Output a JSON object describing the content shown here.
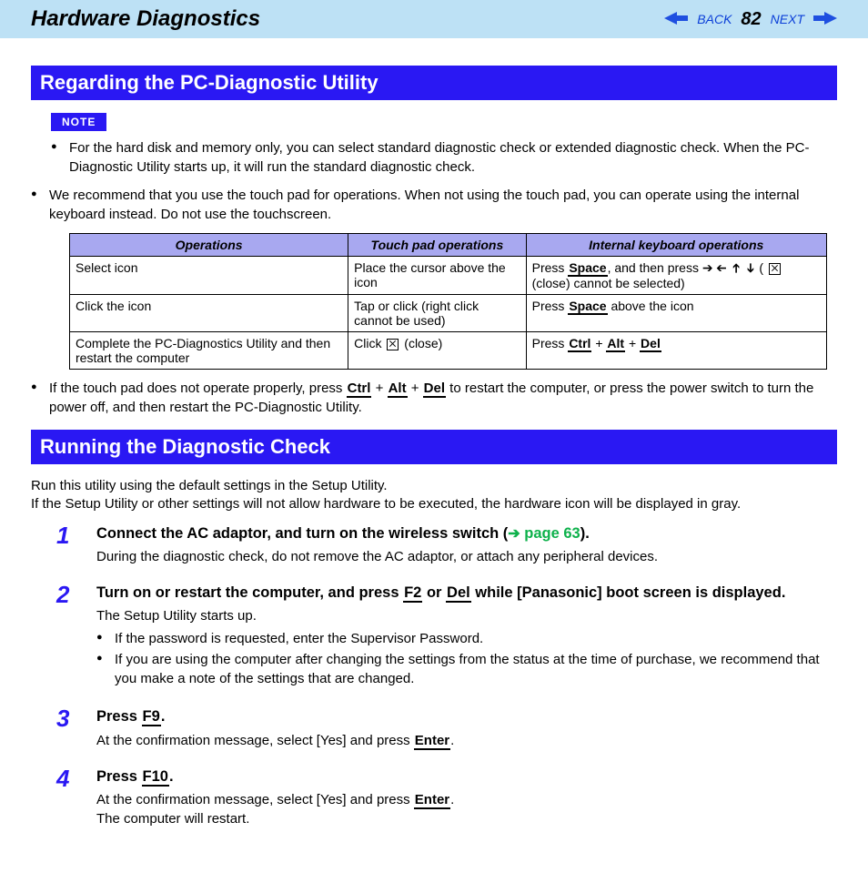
{
  "header": {
    "title": "Hardware Diagnostics",
    "back": "BACK",
    "next": "NEXT",
    "page": "82"
  },
  "section1": {
    "title": "Regarding the PC-Diagnostic Utility",
    "note_label": "NOTE",
    "note_bullet": "For the hard disk and memory only, you can select standard diagnostic check or extended diagnostic check. When the PC-Diagnostic Utility starts up, it will run the standard diagnostic check.",
    "bullet_touch": "We recommend that you use the touch pad for operations. When not using the touch pad, you can operate using the internal keyboard instead. Do not use the touchscreen.",
    "table": {
      "h1": "Operations",
      "h2": "Touch pad operations",
      "h3": "Internal keyboard operations",
      "r1c1": "Select icon",
      "r1c2": "Place the cursor above the icon",
      "r1c3a": "Press ",
      "r1c3b": ", and then press ",
      "r1c3c": " (close) cannot be selected)",
      "r2c1": "Click the icon",
      "r2c2": "Tap or click (right click cannot be used)",
      "r2c3a": "Press ",
      "r2c3b": " above the icon",
      "r3c1": "Complete the PC-Diagnostics Utility and then restart the computer",
      "r3c2a": "Click ",
      "r3c2b": " (close)",
      "r3c3a": "Press "
    },
    "bullet_after_a": "If the touch pad does not operate properly, press ",
    "bullet_after_b": " to restart the computer, or press the power switch to turn the power off, and then restart the PC-Diagnostic Utility."
  },
  "keys": {
    "space": "Space",
    "ctrl": "Ctrl",
    "alt": "Alt",
    "del": "Del",
    "f2": "F2",
    "f9": "F9",
    "f10": "F10",
    "enter": "Enter"
  },
  "section2": {
    "title": "Running the Diagnostic Check",
    "intro1": "Run this utility using the default settings in the Setup Utility.",
    "intro2": "If the Setup Utility or other settings will not allow hardware to be executed, the hardware icon will be displayed in gray.",
    "step1": {
      "num": "1",
      "title_a": "Connect the AC adaptor, and turn on the wireless switch (",
      "page_ref": "page 63",
      "title_b": ").",
      "text": "During the diagnostic check, do not remove the AC adaptor, or attach any peripheral devices."
    },
    "step2": {
      "num": "2",
      "title_a": "Turn on or restart the computer, and press ",
      "title_b": " or ",
      "title_c": " while [Panasonic] boot screen is displayed.",
      "text1": "The Setup Utility starts up.",
      "b1": "If the password is requested, enter the Supervisor Password.",
      "b2": "If you are using the computer after changing the settings from the status at the time of purchase, we recommend that you make a note of the settings that are changed."
    },
    "step3": {
      "num": "3",
      "title_a": "Press ",
      "title_b": ".",
      "text_a": "At the confirmation message, select [Yes] and press ",
      "text_b": "."
    },
    "step4": {
      "num": "4",
      "title_a": "Press ",
      "title_b": ".",
      "text_a": "At the confirmation message, select [Yes] and press ",
      "text_b": ".",
      "text2": "The computer will restart."
    }
  }
}
